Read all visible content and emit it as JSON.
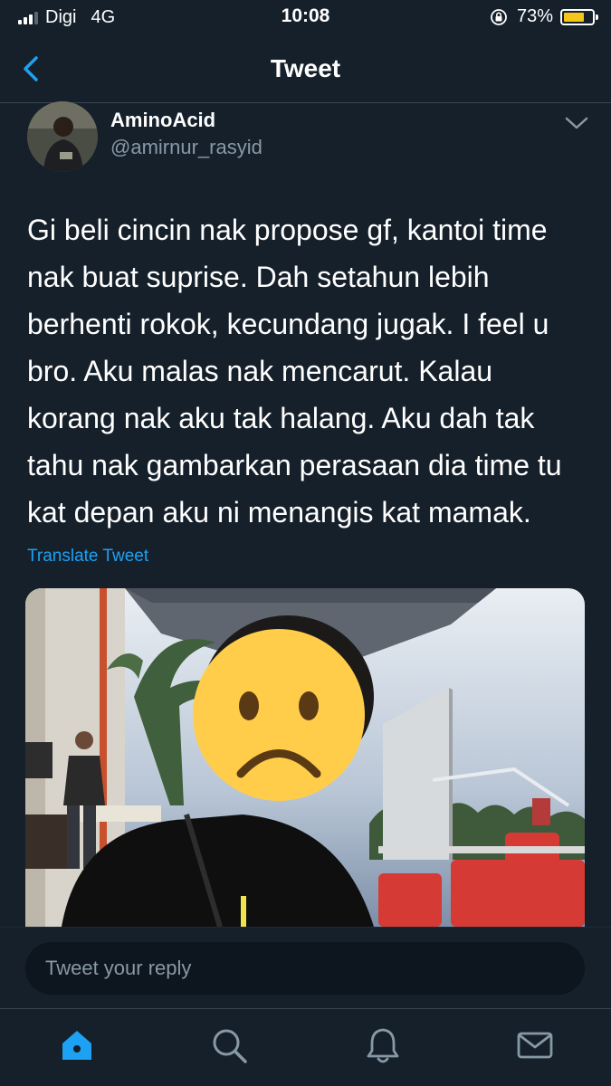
{
  "status_bar": {
    "carrier": "Digi",
    "network": "4G",
    "time": "10:08",
    "battery_percent": "73%",
    "battery_level": 0.73,
    "battery_color": "#f5c518",
    "signal_bars_active": 3
  },
  "nav": {
    "title": "Tweet",
    "back_icon": "chevron-left-icon"
  },
  "tweet": {
    "display_name": "AminoAcid",
    "handle": "@amirnur_rasyid",
    "lines": [
      "Gi beli cincin nak propose gf, kantoi time",
      "nak buat suprise. Dah setahun lebih",
      "berhenti rokok, kecundang jugak. I feel u",
      "bro. Aku malas nak mencarut. Kalau",
      "korang nak aku tak halang. Aku dah tak",
      "tahu nak gambarkan perasaan dia time tu",
      "kat depan aku ni menangis kat mamak."
    ],
    "translate_label": "Translate Tweet",
    "more_icon": "chevron-down-icon",
    "media_icon": "sad-face-emoji-icon"
  },
  "reply": {
    "placeholder": "Tweet your reply"
  },
  "tabs": [
    {
      "icon": "home-icon",
      "active": true
    },
    {
      "icon": "search-icon",
      "active": false
    },
    {
      "icon": "bell-icon",
      "active": false
    },
    {
      "icon": "mail-icon",
      "active": false
    }
  ],
  "colors": {
    "background": "#15202b",
    "accent": "#1da1f2",
    "secondary_text": "#8899a6",
    "divider": "#38444d"
  }
}
